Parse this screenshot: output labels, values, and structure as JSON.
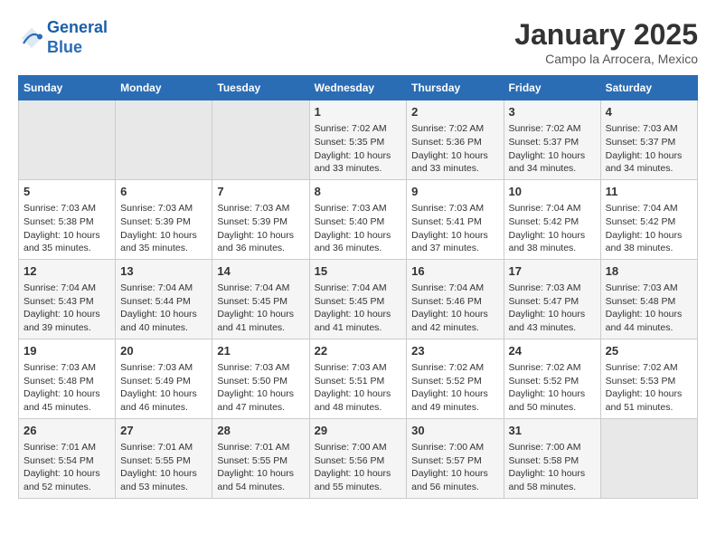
{
  "logo": {
    "line1": "General",
    "line2": "Blue"
  },
  "title": "January 2025",
  "subtitle": "Campo la Arrocera, Mexico",
  "headers": [
    "Sunday",
    "Monday",
    "Tuesday",
    "Wednesday",
    "Thursday",
    "Friday",
    "Saturday"
  ],
  "weeks": [
    [
      {
        "day": "",
        "content": ""
      },
      {
        "day": "",
        "content": ""
      },
      {
        "day": "",
        "content": ""
      },
      {
        "day": "1",
        "content": "Sunrise: 7:02 AM\nSunset: 5:35 PM\nDaylight: 10 hours\nand 33 minutes."
      },
      {
        "day": "2",
        "content": "Sunrise: 7:02 AM\nSunset: 5:36 PM\nDaylight: 10 hours\nand 33 minutes."
      },
      {
        "day": "3",
        "content": "Sunrise: 7:02 AM\nSunset: 5:37 PM\nDaylight: 10 hours\nand 34 minutes."
      },
      {
        "day": "4",
        "content": "Sunrise: 7:03 AM\nSunset: 5:37 PM\nDaylight: 10 hours\nand 34 minutes."
      }
    ],
    [
      {
        "day": "5",
        "content": "Sunrise: 7:03 AM\nSunset: 5:38 PM\nDaylight: 10 hours\nand 35 minutes."
      },
      {
        "day": "6",
        "content": "Sunrise: 7:03 AM\nSunset: 5:39 PM\nDaylight: 10 hours\nand 35 minutes."
      },
      {
        "day": "7",
        "content": "Sunrise: 7:03 AM\nSunset: 5:39 PM\nDaylight: 10 hours\nand 36 minutes."
      },
      {
        "day": "8",
        "content": "Sunrise: 7:03 AM\nSunset: 5:40 PM\nDaylight: 10 hours\nand 36 minutes."
      },
      {
        "day": "9",
        "content": "Sunrise: 7:03 AM\nSunset: 5:41 PM\nDaylight: 10 hours\nand 37 minutes."
      },
      {
        "day": "10",
        "content": "Sunrise: 7:04 AM\nSunset: 5:42 PM\nDaylight: 10 hours\nand 38 minutes."
      },
      {
        "day": "11",
        "content": "Sunrise: 7:04 AM\nSunset: 5:42 PM\nDaylight: 10 hours\nand 38 minutes."
      }
    ],
    [
      {
        "day": "12",
        "content": "Sunrise: 7:04 AM\nSunset: 5:43 PM\nDaylight: 10 hours\nand 39 minutes."
      },
      {
        "day": "13",
        "content": "Sunrise: 7:04 AM\nSunset: 5:44 PM\nDaylight: 10 hours\nand 40 minutes."
      },
      {
        "day": "14",
        "content": "Sunrise: 7:04 AM\nSunset: 5:45 PM\nDaylight: 10 hours\nand 41 minutes."
      },
      {
        "day": "15",
        "content": "Sunrise: 7:04 AM\nSunset: 5:45 PM\nDaylight: 10 hours\nand 41 minutes."
      },
      {
        "day": "16",
        "content": "Sunrise: 7:04 AM\nSunset: 5:46 PM\nDaylight: 10 hours\nand 42 minutes."
      },
      {
        "day": "17",
        "content": "Sunrise: 7:03 AM\nSunset: 5:47 PM\nDaylight: 10 hours\nand 43 minutes."
      },
      {
        "day": "18",
        "content": "Sunrise: 7:03 AM\nSunset: 5:48 PM\nDaylight: 10 hours\nand 44 minutes."
      }
    ],
    [
      {
        "day": "19",
        "content": "Sunrise: 7:03 AM\nSunset: 5:48 PM\nDaylight: 10 hours\nand 45 minutes."
      },
      {
        "day": "20",
        "content": "Sunrise: 7:03 AM\nSunset: 5:49 PM\nDaylight: 10 hours\nand 46 minutes."
      },
      {
        "day": "21",
        "content": "Sunrise: 7:03 AM\nSunset: 5:50 PM\nDaylight: 10 hours\nand 47 minutes."
      },
      {
        "day": "22",
        "content": "Sunrise: 7:03 AM\nSunset: 5:51 PM\nDaylight: 10 hours\nand 48 minutes."
      },
      {
        "day": "23",
        "content": "Sunrise: 7:02 AM\nSunset: 5:52 PM\nDaylight: 10 hours\nand 49 minutes."
      },
      {
        "day": "24",
        "content": "Sunrise: 7:02 AM\nSunset: 5:52 PM\nDaylight: 10 hours\nand 50 minutes."
      },
      {
        "day": "25",
        "content": "Sunrise: 7:02 AM\nSunset: 5:53 PM\nDaylight: 10 hours\nand 51 minutes."
      }
    ],
    [
      {
        "day": "26",
        "content": "Sunrise: 7:01 AM\nSunset: 5:54 PM\nDaylight: 10 hours\nand 52 minutes."
      },
      {
        "day": "27",
        "content": "Sunrise: 7:01 AM\nSunset: 5:55 PM\nDaylight: 10 hours\nand 53 minutes."
      },
      {
        "day": "28",
        "content": "Sunrise: 7:01 AM\nSunset: 5:55 PM\nDaylight: 10 hours\nand 54 minutes."
      },
      {
        "day": "29",
        "content": "Sunrise: 7:00 AM\nSunset: 5:56 PM\nDaylight: 10 hours\nand 55 minutes."
      },
      {
        "day": "30",
        "content": "Sunrise: 7:00 AM\nSunset: 5:57 PM\nDaylight: 10 hours\nand 56 minutes."
      },
      {
        "day": "31",
        "content": "Sunrise: 7:00 AM\nSunset: 5:58 PM\nDaylight: 10 hours\nand 58 minutes."
      },
      {
        "day": "",
        "content": ""
      }
    ]
  ]
}
